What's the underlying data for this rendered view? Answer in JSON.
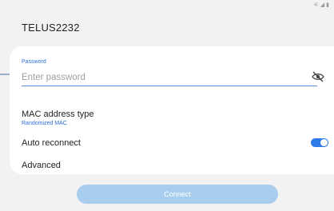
{
  "status_bar": {
    "icons": [
      "wifi-icon",
      "signal-icon",
      "battery-icon"
    ],
    "glyphs": [
      "⚟",
      "◢",
      "▮"
    ]
  },
  "network": {
    "title": "TELUS2232"
  },
  "password": {
    "label": "Password",
    "placeholder": "Enter password",
    "value": "",
    "visibility_icon": "eye-off-icon"
  },
  "mac_address": {
    "title": "MAC address type",
    "value": "Randomized MAC"
  },
  "auto_reconnect": {
    "title": "Auto reconnect",
    "enabled": true
  },
  "advanced": {
    "title": "Advanced"
  },
  "connect_button": {
    "label": "Connect"
  },
  "colors": {
    "accent": "#2f7bea",
    "label_blue": "#2f6fd6",
    "button_disabled": "#a9cdee",
    "background": "#f2f2f2",
    "card": "#ffffff"
  },
  "annotation": {
    "icon": "arrow-right-icon"
  }
}
